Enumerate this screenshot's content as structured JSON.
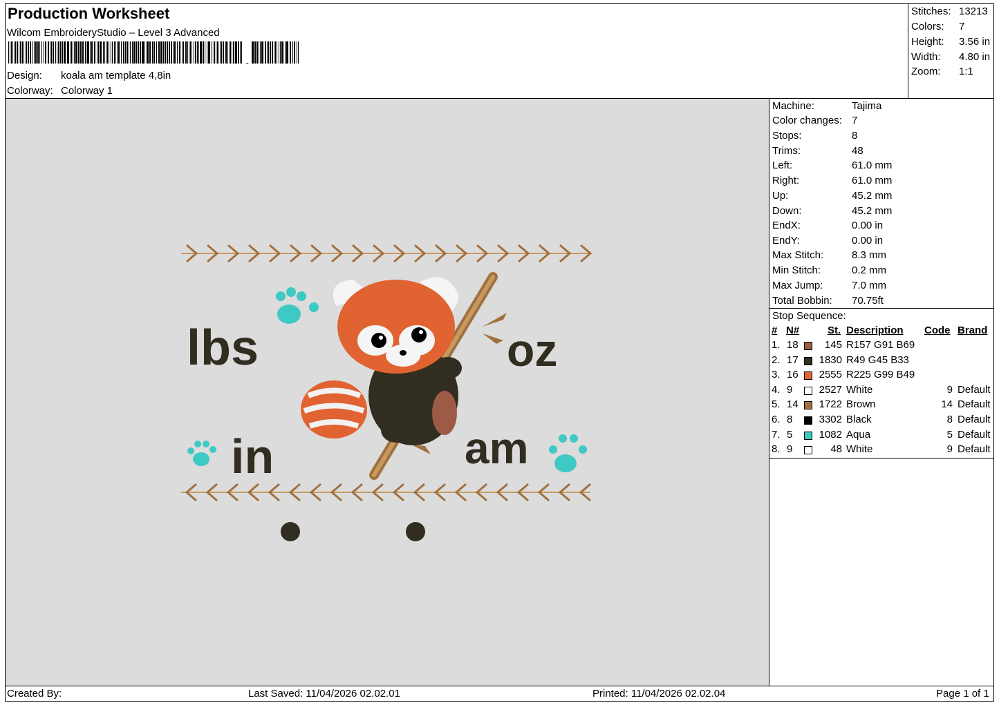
{
  "header": {
    "title": "Production Worksheet",
    "software": "Wilcom EmbroideryStudio – Level 3 Advanced",
    "design_label": "Design:",
    "design_value": "koala am template 4,8in",
    "colorway_label": "Colorway:",
    "colorway_value": "Colorway 1"
  },
  "stats": [
    {
      "label": "Stitches:",
      "value": "13213"
    },
    {
      "label": "Colors:",
      "value": "7"
    },
    {
      "label": "Height:",
      "value": "3.56 in"
    },
    {
      "label": "Width:",
      "value": "4.80 in"
    },
    {
      "label": "Zoom:",
      "value": "1:1"
    }
  ],
  "machine": [
    {
      "label": "Machine:",
      "value": "Tajima"
    },
    {
      "label": "Color changes:",
      "value": "7"
    },
    {
      "label": "Stops:",
      "value": "8"
    },
    {
      "label": "Trims:",
      "value": "48"
    },
    {
      "label": "Left:",
      "value": "61.0 mm"
    },
    {
      "label": "Right:",
      "value": "61.0 mm"
    },
    {
      "label": "Up:",
      "value": "45.2 mm"
    },
    {
      "label": "Down:",
      "value": "45.2 mm"
    },
    {
      "label": "EndX:",
      "value": "0.00 in"
    },
    {
      "label": "EndY:",
      "value": "0.00 in"
    },
    {
      "label": "Max Stitch:",
      "value": "8.3 mm"
    },
    {
      "label": "Min Stitch:",
      "value": "0.2 mm"
    },
    {
      "label": "Max Jump:",
      "value": "7.0 mm"
    },
    {
      "label": "Total Bobbin:",
      "value": "70.75ft"
    }
  ],
  "stop_sequence": {
    "title": "Stop Sequence:",
    "columns": {
      "num": "#",
      "n": "N#",
      "st": "St.",
      "desc": "Description",
      "code": "Code",
      "brand": "Brand"
    },
    "rows": [
      {
        "num": "1.",
        "n": "18",
        "color": "#9d5b45",
        "st": "145",
        "desc": "R157 G91 B69",
        "code": "",
        "brand": ""
      },
      {
        "num": "2.",
        "n": "17",
        "color": "#312d21",
        "st": "1830",
        "desc": "R49 G45 B33",
        "code": "",
        "brand": ""
      },
      {
        "num": "3.",
        "n": "16",
        "color": "#e16331",
        "st": "2555",
        "desc": "R225 G99 B49",
        "code": "",
        "brand": ""
      },
      {
        "num": "4.",
        "n": "9",
        "color": "#ffffff",
        "st": "2527",
        "desc": "White",
        "code": "9",
        "brand": "Default"
      },
      {
        "num": "5.",
        "n": "14",
        "color": "#a0713f",
        "st": "1722",
        "desc": "Brown",
        "code": "14",
        "brand": "Default"
      },
      {
        "num": "6.",
        "n": "8",
        "color": "#000000",
        "st": "3302",
        "desc": "Black",
        "code": "8",
        "brand": "Default"
      },
      {
        "num": "7.",
        "n": "5",
        "color": "#3ec9c4",
        "st": "1082",
        "desc": "Aqua",
        "code": "5",
        "brand": "Default"
      },
      {
        "num": "8.",
        "n": "9",
        "color": "#ffffff",
        "st": "48",
        "desc": "White",
        "code": "9",
        "brand": "Default"
      }
    ]
  },
  "design_text": {
    "lbs": "lbs",
    "oz": "oz",
    "in": "in",
    "am": "am"
  },
  "footer": {
    "created_by": "Created By:",
    "last_saved": "Last Saved: 11/04/2026 02.02.01",
    "printed": "Printed: 11/04/2026 02.02.04",
    "page": "Page 1 of 1"
  },
  "colors": {
    "canvas": "#dcdcdc",
    "thread_dark": "#312d21",
    "thread_orange": "#e16331",
    "thread_brown": "#a0713f",
    "thread_aqua": "#3ec9c4",
    "thread_red_brown": "#9d5b45"
  }
}
